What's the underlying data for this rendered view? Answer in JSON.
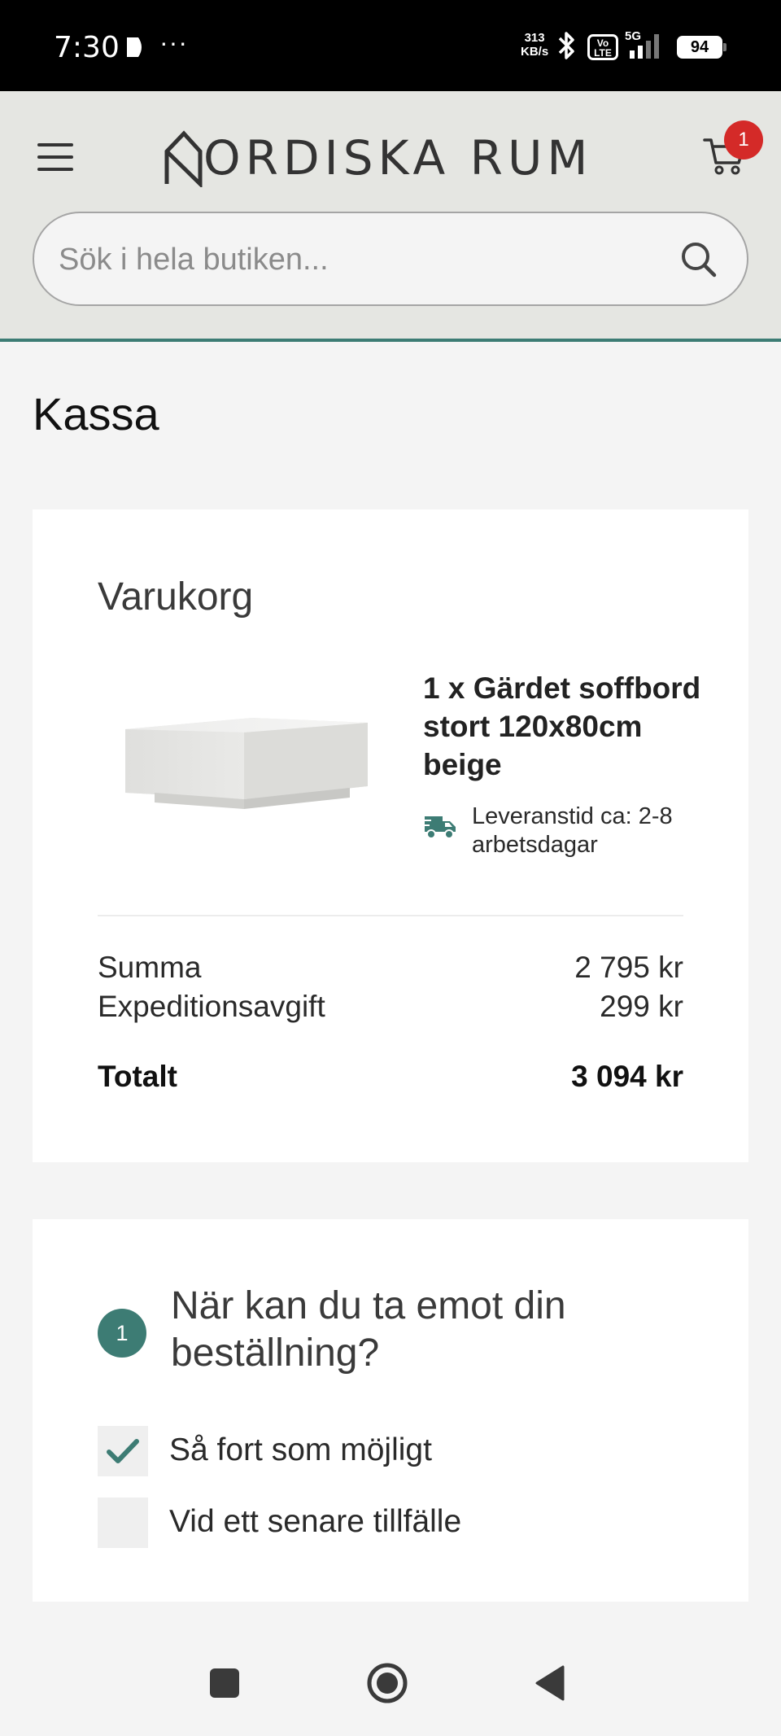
{
  "status_bar": {
    "time": "7:30",
    "speed_value": "313",
    "speed_unit": "KB/s",
    "volte": "Vo LTE",
    "network": "5G",
    "battery": "94"
  },
  "header": {
    "logo_text": "ORDISKA RUM",
    "cart_count": "1",
    "search": {
      "placeholder": "Sök i hela butiken..."
    },
    "accent_color": "#3d7c74"
  },
  "page": {
    "title": "Kassa"
  },
  "cart": {
    "title": "Varukorg",
    "product": {
      "name": "1 x Gärdet soffbord stort 120x80cm beige",
      "delivery": "Leveranstid ca: 2-8 arbetsdagar"
    },
    "summary": {
      "subtotal_label": "Summa",
      "subtotal_value": "2 795 kr",
      "fee_label": "Expeditionsavgift",
      "fee_value": "299 kr",
      "total_label": "Totalt",
      "total_value": "3 094 kr"
    }
  },
  "delivery_step": {
    "number": "1",
    "title": "När kan du ta emot din beställning?",
    "options": [
      {
        "label": "Så fort som möjligt",
        "checked": true
      },
      {
        "label": "Vid ett senare tillfälle",
        "checked": false
      }
    ]
  }
}
